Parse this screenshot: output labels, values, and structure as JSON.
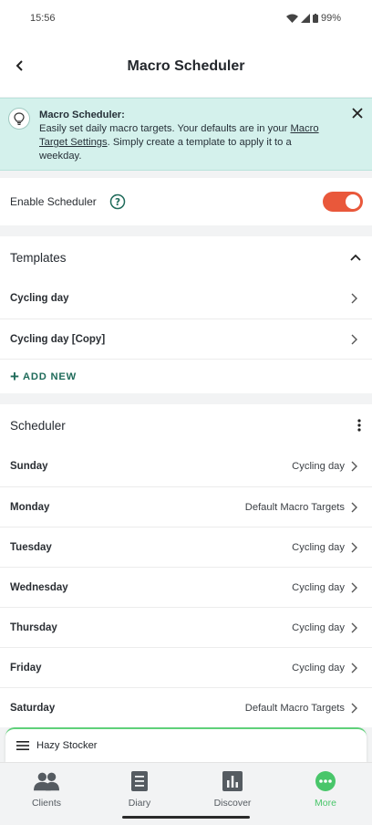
{
  "status": {
    "time": "15:56",
    "battery": "99%"
  },
  "header": {
    "title": "Macro Scheduler"
  },
  "banner": {
    "title": "Macro Scheduler:",
    "text_before_link": "Easily set daily macro targets. Your defaults are in your ",
    "link_text": "Macro Target Settings",
    "text_after_link": ". Simply create a template to apply it to a weekday."
  },
  "enable": {
    "label": "Enable Scheduler",
    "enabled": true
  },
  "templates": {
    "title": "Templates",
    "items": [
      {
        "label": "Cycling day"
      },
      {
        "label": "Cycling day [Copy]"
      }
    ],
    "add_new": "ADD NEW"
  },
  "scheduler": {
    "title": "Scheduler",
    "days": [
      {
        "day": "Sunday",
        "value": "Cycling day"
      },
      {
        "day": "Monday",
        "value": "Default Macro Targets"
      },
      {
        "day": "Tuesday",
        "value": "Cycling day"
      },
      {
        "day": "Wednesday",
        "value": "Cycling day"
      },
      {
        "day": "Thursday",
        "value": "Cycling day"
      },
      {
        "day": "Friday",
        "value": "Cycling day"
      },
      {
        "day": "Saturday",
        "value": "Default Macro Targets"
      }
    ]
  },
  "client_bar": {
    "name": "Hazy Stocker"
  },
  "nav": {
    "items": [
      {
        "label": "Clients",
        "icon": "clients-icon"
      },
      {
        "label": "Diary",
        "icon": "diary-icon"
      },
      {
        "label": "Discover",
        "icon": "discover-icon"
      },
      {
        "label": "More",
        "icon": "more-icon"
      }
    ],
    "active_color": "#49c66a"
  },
  "colors": {
    "accent": "#e9583b",
    "banner_bg": "#d4f1ec",
    "teal": "#1f6b5a"
  }
}
